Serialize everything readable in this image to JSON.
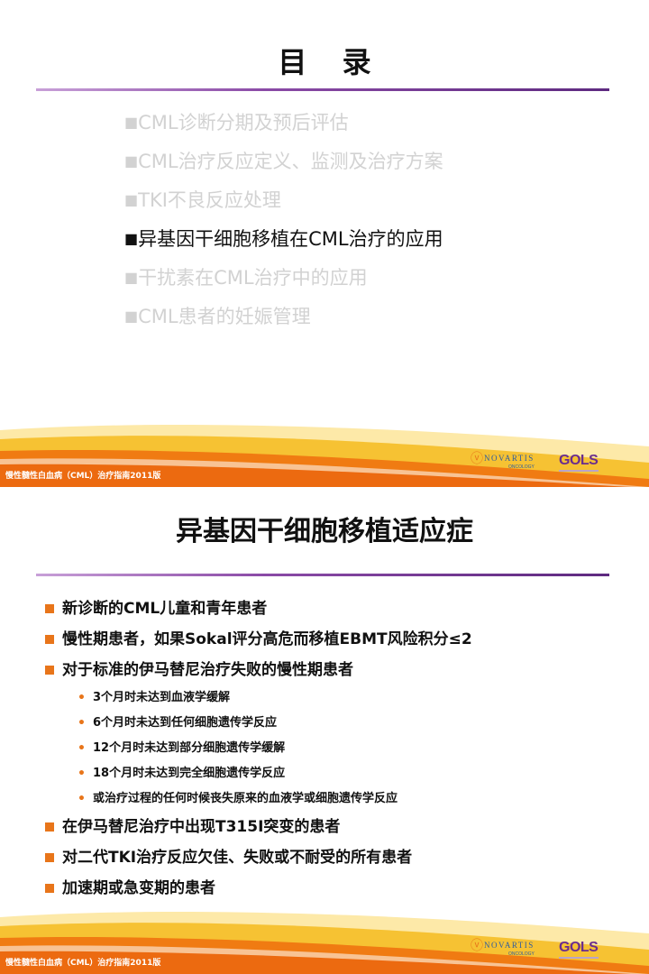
{
  "slide1": {
    "title": "目 录",
    "items": [
      {
        "marker": "■",
        "text": "CML诊断分期及预后评估"
      },
      {
        "marker": "■",
        "text": "CML治疗反应定义、监测及治疗方案"
      },
      {
        "marker": "■",
        "text": "TKI不良反应处理"
      },
      {
        "marker": "■",
        "text": "异基因干细胞移植在CML治疗的应用"
      },
      {
        "marker": "■",
        "text": "干扰素在CML治疗中的应用"
      },
      {
        "marker": "■",
        "text": "CML患者的妊娠管理"
      }
    ],
    "active_index": 3,
    "footer": "慢性髓性白血病（CML）治疗指南2011版"
  },
  "slide2": {
    "title": "异基因干细胞移植适应症",
    "bullets": [
      {
        "level": 1,
        "text": "新诊断的CML儿童和青年患者"
      },
      {
        "level": 1,
        "text": "慢性期患者，如果Sokal评分高危而移植EBMT风险积分≤2"
      },
      {
        "level": 1,
        "text": "对于标准的伊马替尼治疗失败的慢性期患者"
      },
      {
        "level": 2,
        "text": "3个月时未达到血液学缓解"
      },
      {
        "level": 2,
        "text": "6个月时未达到任何细胞遗传学反应"
      },
      {
        "level": 2,
        "text": "12个月时未达到部分细胞遗传学缓解"
      },
      {
        "level": 2,
        "text": "18个月时未达到完全细胞遗传学反应"
      },
      {
        "level": 2,
        "text": "或治疗过程的任何时候丧失原来的血液学或细胞遗传学反应"
      },
      {
        "level": 1,
        "text": "在伊马替尼治疗中出现T315I突变的患者"
      },
      {
        "level": 1,
        "text": "对二代TKI治疗反应欠佳、失败或不耐受的所有患者"
      },
      {
        "level": 1,
        "text": "加速期或急变期的患者"
      }
    ],
    "footer": "慢性髓性白血病（CML）治疗指南2011版"
  },
  "logos": {
    "novartis_name": "NOVARTIS",
    "novartis_sub": "ONCOLOGY",
    "gols": "GOLS"
  },
  "colors": {
    "accent_orange": "#e8751a",
    "rule_purple": "#8a4aa6",
    "footer_orange": "#f07b12",
    "footer_yellow": "#f6c233",
    "inactive_text": "#d2d2d2"
  }
}
